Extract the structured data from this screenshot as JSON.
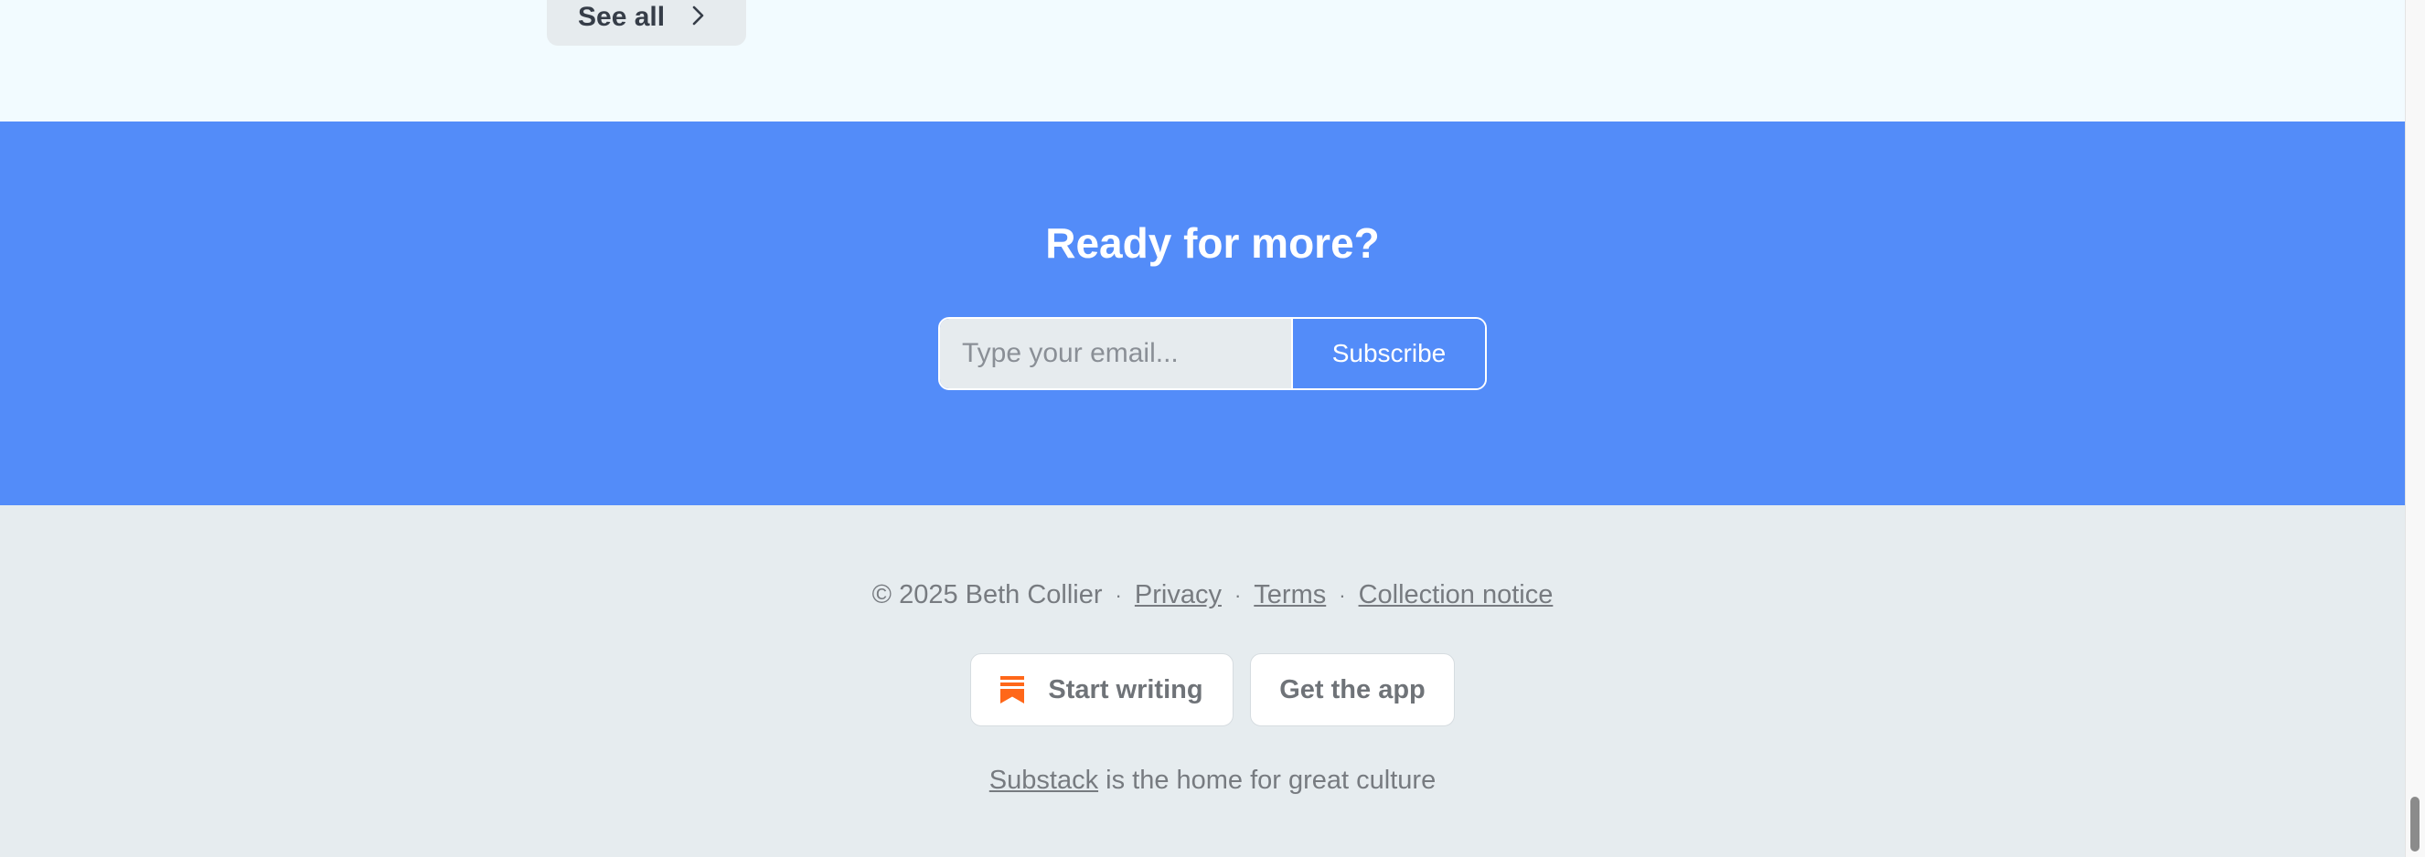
{
  "top": {
    "see_all_label": "See all"
  },
  "subscribe": {
    "title": "Ready for more?",
    "email_placeholder": "Type your email...",
    "email_value": "",
    "button_label": "Subscribe"
  },
  "footer": {
    "copyright": "© 2025 Beth Collier",
    "separator": "·",
    "links": {
      "privacy": "Privacy",
      "terms": "Terms",
      "collection_notice": "Collection notice"
    },
    "buttons": {
      "start_writing": "Start writing",
      "get_app": "Get the app"
    },
    "tagline_link": "Substack",
    "tagline_rest": " is the home for great culture"
  },
  "colors": {
    "accent_blue": "#538cf9",
    "substack_orange": "#ff6719",
    "footer_bg": "#e6ecef",
    "top_bg": "#f2fbff"
  },
  "icons": {
    "see_all": "chevron-right-icon",
    "start_writing": "substack-logo-icon"
  }
}
